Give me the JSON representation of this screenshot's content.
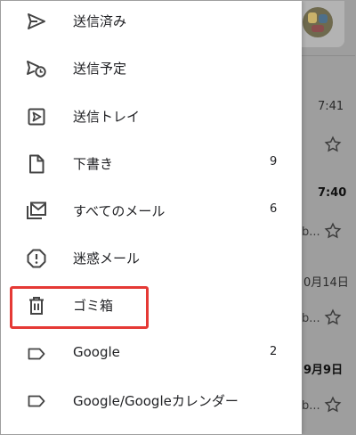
{
  "drawer": {
    "items": [
      {
        "label": "送信済み",
        "count": "",
        "icon": "send-icon"
      },
      {
        "label": "送信予定",
        "count": "",
        "icon": "scheduled-send-icon"
      },
      {
        "label": "送信トレイ",
        "count": "",
        "icon": "outbox-icon"
      },
      {
        "label": "下書き",
        "count": "9",
        "icon": "draft-icon"
      },
      {
        "label": "すべてのメール",
        "count": "6",
        "icon": "all-mail-icon"
      },
      {
        "label": "迷惑メール",
        "count": "",
        "icon": "spam-icon"
      },
      {
        "label": "ゴミ箱",
        "count": "",
        "icon": "trash-icon"
      },
      {
        "label": "Google",
        "count": "2",
        "icon": "label-icon"
      },
      {
        "label": "Google/Googleカレンダー",
        "count": "",
        "icon": "label-icon"
      }
    ],
    "highlighted_item": "ゴミ箱",
    "highlight_color": "#e53935"
  },
  "background_inbox": {
    "rows": [
      {
        "time": "7:41",
        "time_bold": false,
        "snippet": ""
      },
      {
        "time": "7:40",
        "time_bold": true,
        "snippet": "b..."
      },
      {
        "time": "0月14日",
        "time_bold": false,
        "snippet": "b..."
      },
      {
        "time": "9月9日",
        "time_bold": true,
        "snippet": "b..."
      }
    ]
  }
}
